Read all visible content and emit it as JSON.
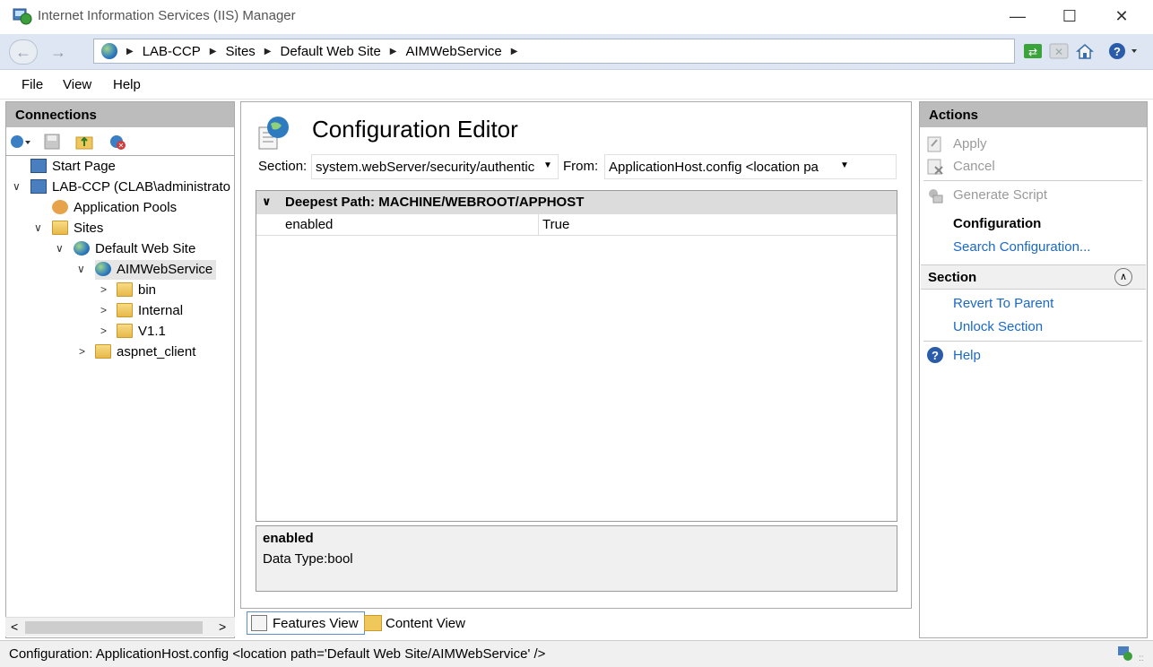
{
  "window": {
    "title": "Internet Information Services (IIS) Manager"
  },
  "address": {
    "crumbs": [
      "LAB-CCP",
      "Sites",
      "Default Web Site",
      "AIMWebService"
    ]
  },
  "menu": {
    "file": "File",
    "view": "View",
    "help": "Help"
  },
  "connections": {
    "header": "Connections",
    "tree": {
      "start_page": "Start Page",
      "server": "LAB-CCP (CLAB\\administrato",
      "app_pools": "Application Pools",
      "sites": "Sites",
      "default_site": "Default Web Site",
      "aimwebservice": "AIMWebService",
      "bin": "bin",
      "internal": "Internal",
      "v11": "V1.1",
      "aspnet_client": "aspnet_client"
    }
  },
  "editor": {
    "title": "Configuration Editor",
    "section_label": "Section:",
    "section_value": "system.webServer/security/authentic",
    "from_label": "From:",
    "from_value": "ApplicationHost.config <location pa",
    "group_header": "Deepest Path: MACHINE/WEBROOT/APPHOST",
    "rows": [
      {
        "name": "enabled",
        "value": "True"
      }
    ],
    "desc_title": "enabled",
    "desc_type": "Data Type:bool"
  },
  "views": {
    "features": "Features View",
    "content": "Content View"
  },
  "actions": {
    "header": "Actions",
    "apply": "Apply",
    "cancel": "Cancel",
    "generate_script": "Generate Script",
    "configuration_heading": "Configuration",
    "search_configuration": "Search Configuration...",
    "section_header": "Section",
    "revert_to_parent": "Revert To Parent",
    "unlock_section": "Unlock Section",
    "help": "Help"
  },
  "status": {
    "text": "Configuration: ApplicationHost.config <location path='Default Web Site/AIMWebService' />"
  }
}
